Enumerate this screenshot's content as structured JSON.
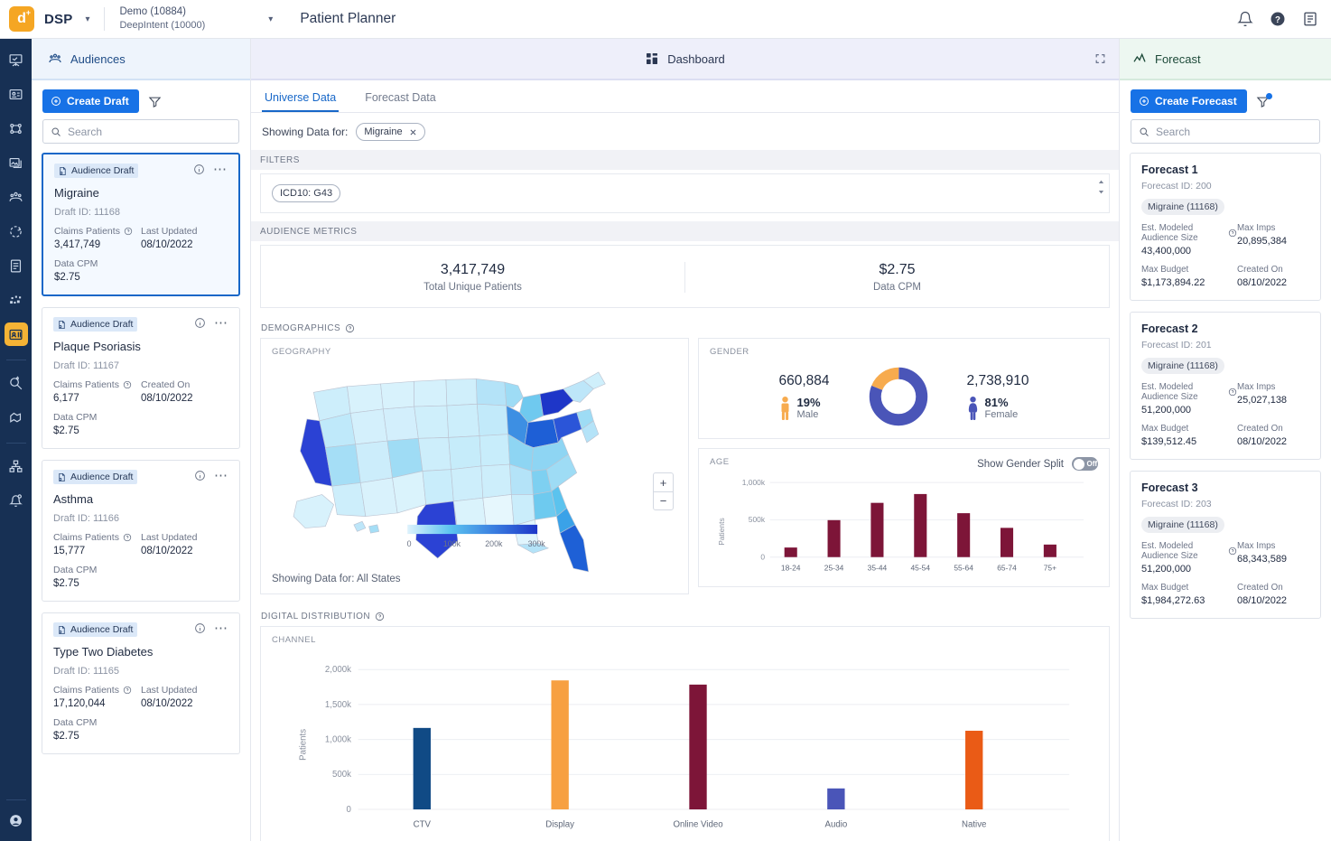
{
  "topbar": {
    "brand": "DSP",
    "logo_letter": "d",
    "logo_plus": "+",
    "account_line1": "Demo (10884)",
    "account_line2": "DeepIntent (10000)",
    "page_title": "Patient Planner",
    "icons": [
      "bell-icon",
      "help-icon",
      "notes-icon"
    ]
  },
  "rail": {
    "items": [
      {
        "name": "presentation-icon"
      },
      {
        "name": "campaign-icon"
      },
      {
        "name": "nodes-icon"
      },
      {
        "name": "creatives-icon"
      },
      {
        "name": "audience-people-icon"
      },
      {
        "name": "sync-icon"
      },
      {
        "name": "reports-icon"
      },
      {
        "name": "data-blocks-icon"
      },
      {
        "name": "patient-planner-icon",
        "active": true
      },
      {
        "name": "discover-icon"
      },
      {
        "name": "deals-icon"
      },
      {
        "name": "org-chart-icon"
      },
      {
        "name": "alerts-settings-icon"
      }
    ],
    "avatar": "user-avatar-icon"
  },
  "panels": {
    "audiences_header": "Audiences",
    "dashboard_header": "Dashboard",
    "forecast_header": "Forecast"
  },
  "audiences": {
    "create_label": "Create Draft",
    "search_placeholder": "Search",
    "search_value": "",
    "cards": [
      {
        "badge": "Audience Draft",
        "title": "Migraine",
        "draft_id": "Draft ID: 11168",
        "metric_label": "Claims Patients",
        "metric_value": "3,417,749",
        "date_label": "Last Updated",
        "date_value": "08/10/2022",
        "cpm_label": "Data CPM",
        "cpm_value": "$2.75",
        "selected": true
      },
      {
        "badge": "Audience Draft",
        "title": "Plaque Psoriasis",
        "draft_id": "Draft ID: 11167",
        "metric_label": "Claims Patients",
        "metric_value": "6,177",
        "date_label": "Created On",
        "date_value": "08/10/2022",
        "cpm_label": "Data CPM",
        "cpm_value": "$2.75",
        "selected": false
      },
      {
        "badge": "Audience Draft",
        "title": "Asthma",
        "draft_id": "Draft ID: 11166",
        "metric_label": "Claims Patients",
        "metric_value": "15,777",
        "date_label": "Last Updated",
        "date_value": "08/10/2022",
        "cpm_label": "Data CPM",
        "cpm_value": "$2.75",
        "selected": false
      },
      {
        "badge": "Audience Draft",
        "title": "Type Two Diabetes",
        "draft_id": "Draft ID: 11165",
        "metric_label": "Claims Patients",
        "metric_value": "17,120,044",
        "date_label": "Last Updated",
        "date_value": "08/10/2022",
        "cpm_label": "Data CPM",
        "cpm_value": "$2.75",
        "selected": false
      }
    ]
  },
  "forecasts": {
    "create_label": "Create Forecast",
    "search_placeholder": "Search",
    "search_value": "",
    "cards": [
      {
        "title": "Forecast 1",
        "forecast_id": "Forecast ID: 200",
        "chip": "Migraine (11168)",
        "size_label": "Est. Modeled Audience Size",
        "size_value": "43,400,000",
        "imps_label": "Max Imps",
        "imps_value": "20,895,384",
        "budget_label": "Max Budget",
        "budget_value": "$1,173,894.22",
        "created_label": "Created On",
        "created_value": "08/10/2022"
      },
      {
        "title": "Forecast 2",
        "forecast_id": "Forecast ID: 201",
        "chip": "Migraine (11168)",
        "size_label": "Est. Modeled Audience Size",
        "size_value": "51,200,000",
        "imps_label": "Max Imps",
        "imps_value": "25,027,138",
        "budget_label": "Max Budget",
        "budget_value": "$139,512.45",
        "created_label": "Created On",
        "created_value": "08/10/2022"
      },
      {
        "title": "Forecast 3",
        "forecast_id": "Forecast ID: 203",
        "chip": "Migraine (11168)",
        "size_label": "Est. Modeled Audience Size",
        "size_value": "51,200,000",
        "imps_label": "Max Imps",
        "imps_value": "68,343,589",
        "budget_label": "Max Budget",
        "budget_value": "$1,984,272.63",
        "created_label": "Created On",
        "created_value": "08/10/2022"
      }
    ]
  },
  "dashboard": {
    "tabs": [
      {
        "label": "Universe Data",
        "active": true
      },
      {
        "label": "Forecast Data",
        "active": false
      }
    ],
    "showing_label": "Showing Data for:",
    "showing_chip": "Migraine",
    "filters_label": "FILTERS",
    "filter_chips": [
      "ICD10: G43"
    ],
    "metrics_label": "AUDIENCE METRICS",
    "metrics": [
      {
        "value": "3,417,749",
        "label": "Total Unique Patients"
      },
      {
        "value": "$2.75",
        "label": "Data CPM"
      }
    ],
    "demographics_label": "DEMOGRAPHICS",
    "geography_label": "GEOGRAPHY",
    "map_footer": "Showing Data for: All States",
    "map_legend_ticks": [
      "0",
      "100k",
      "200k",
      "300k"
    ],
    "zoom_in": "+",
    "zoom_out": "−",
    "gender_label": "GENDER",
    "gender": {
      "male_count": "660,884",
      "male_pct": "19%",
      "male_label": "Male",
      "female_count": "2,738,910",
      "female_pct": "81%",
      "female_label": "Female"
    },
    "age_label": "AGE",
    "gender_split_label": "Show Gender Split",
    "gender_split_state": "Off",
    "digital_label": "DIGITAL DISTRIBUTION",
    "channel_label": "CHANNEL"
  },
  "colors": {
    "accent_blue": "#1772e6",
    "rail_navy": "#173054",
    "brand_orange": "#f5a623",
    "maroon": "#7d1538",
    "donut_blue": "#4a55b8",
    "donut_orange": "#f7ab4e"
  },
  "chart_data": [
    {
      "type": "bar",
      "title": "AGE",
      "xlabel": "",
      "ylabel": "Patients",
      "categories": [
        "18-24",
        "25-34",
        "35-44",
        "45-54",
        "55-64",
        "65-74",
        "75+"
      ],
      "values": [
        128000,
        495000,
        728000,
        845000,
        588000,
        392000,
        168000
      ],
      "ylim": [
        0,
        1000000
      ],
      "yticks": [
        0,
        500000,
        1000000
      ],
      "ytick_labels": [
        "0",
        "500k",
        "1,000k"
      ],
      "grid": true,
      "legend": "none",
      "bar_color": "#7d1538"
    },
    {
      "type": "bar",
      "title": "CHANNEL",
      "xlabel": "",
      "ylabel": "Patients",
      "categories": [
        "CTV",
        "Display",
        "Online Video",
        "Audio",
        "Native"
      ],
      "values": [
        1165000,
        1845000,
        1785000,
        300000,
        1125000
      ],
      "ylim": [
        0,
        2000000
      ],
      "yticks": [
        0,
        500000,
        1000000,
        1500000,
        2000000
      ],
      "ytick_labels": [
        "0",
        "500k",
        "1,000k",
        "1,500k",
        "2,000k"
      ],
      "grid": true,
      "legend": "none",
      "bar_colors": [
        "#104a85",
        "#f7a041",
        "#7d1538",
        "#4a55b8",
        "#ea5b16"
      ]
    },
    {
      "type": "pie",
      "title": "GENDER",
      "labels": [
        "Female",
        "Male"
      ],
      "values": [
        81,
        19
      ],
      "value_counts": [
        2738910,
        660884
      ],
      "colors": [
        "#4a55b8",
        "#f7ab4e"
      ],
      "legend": "sides"
    },
    {
      "type": "heatmap",
      "title": "GEOGRAPHY",
      "subtitle": "Showing Data for: All States",
      "colorbar_ticks": [
        "0",
        "100k",
        "200k",
        "300k"
      ],
      "colorbar_range": [
        0,
        300000
      ],
      "colors_low_high": [
        "#ddf2fc",
        "#1e36c8"
      ],
      "top_states": [
        {
          "state": "California",
          "level": "high"
        },
        {
          "state": "Texas",
          "level": "high"
        },
        {
          "state": "New York",
          "level": "high"
        },
        {
          "state": "Florida",
          "level": "high"
        },
        {
          "state": "Pennsylvania",
          "level": "high"
        },
        {
          "state": "Ohio",
          "level": "medium-high"
        },
        {
          "state": "Illinois",
          "level": "medium-high"
        },
        {
          "state": "Michigan",
          "level": "medium"
        },
        {
          "state": "Georgia",
          "level": "medium"
        }
      ]
    }
  ]
}
